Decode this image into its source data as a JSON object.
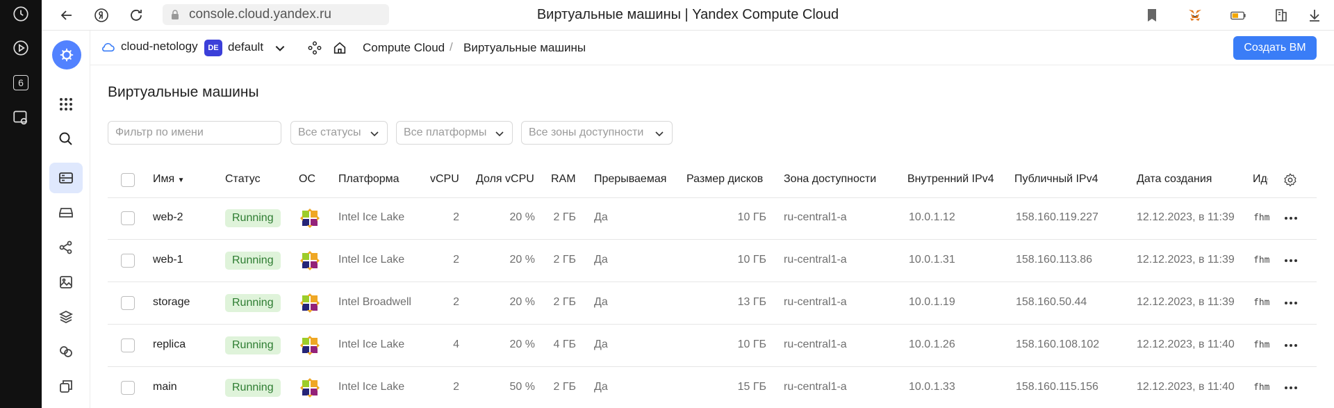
{
  "browser": {
    "url": "console.cloud.yandex.ru",
    "page_title": "Виртуальные машины | Yandex Compute Cloud"
  },
  "os_sidebar": {
    "badge": "6"
  },
  "header": {
    "cloud": "cloud-netology",
    "folder_badge": "DE",
    "folder": "default",
    "breadcrumbs": [
      "Compute Cloud",
      "Виртуальные машины"
    ],
    "create_button": "Создать ВМ"
  },
  "page": {
    "title": "Виртуальные машины"
  },
  "filters": {
    "name_placeholder": "Фильтр по имени",
    "status": "Все статусы",
    "platform": "Все платформы",
    "zone": "Все зоны доступности"
  },
  "table": {
    "columns": [
      "Имя",
      "Статус",
      "ОС",
      "Платформа",
      "vCPU",
      "Доля vCPU",
      "RAM",
      "Прерываемая",
      "Размер дисков",
      "Зона доступности",
      "Внутренний IPv4",
      "Публичный IPv4",
      "Дата создания",
      "Иде"
    ],
    "rows": [
      {
        "name": "web-2",
        "status": "Running",
        "platform": "Intel Ice Lake",
        "vcpu": "2",
        "vcpu_share": "20 %",
        "ram": "2 ГБ",
        "preemptible": "Да",
        "disk": "10 ГБ",
        "zone": "ru-central1-a",
        "ip_internal": "10.0.1.12",
        "ip_public": "158.160.119.227",
        "created": "12.12.2023, в 11:39",
        "id": "fhm"
      },
      {
        "name": "web-1",
        "status": "Running",
        "platform": "Intel Ice Lake",
        "vcpu": "2",
        "vcpu_share": "20 %",
        "ram": "2 ГБ",
        "preemptible": "Да",
        "disk": "10 ГБ",
        "zone": "ru-central1-a",
        "ip_internal": "10.0.1.31",
        "ip_public": "158.160.113.86",
        "created": "12.12.2023, в 11:39",
        "id": "fhm"
      },
      {
        "name": "storage",
        "status": "Running",
        "platform": "Intel Broadwell",
        "vcpu": "2",
        "vcpu_share": "20 %",
        "ram": "2 ГБ",
        "preemptible": "Да",
        "disk": "13 ГБ",
        "zone": "ru-central1-a",
        "ip_internal": "10.0.1.19",
        "ip_public": "158.160.50.44",
        "created": "12.12.2023, в 11:39",
        "id": "fhm"
      },
      {
        "name": "replica",
        "status": "Running",
        "platform": "Intel Ice Lake",
        "vcpu": "4",
        "vcpu_share": "20 %",
        "ram": "4 ГБ",
        "preemptible": "Да",
        "disk": "10 ГБ",
        "zone": "ru-central1-a",
        "ip_internal": "10.0.1.26",
        "ip_public": "158.160.108.102",
        "created": "12.12.2023, в 11:40",
        "id": "fhm"
      },
      {
        "name": "main",
        "status": "Running",
        "platform": "Intel Ice Lake",
        "vcpu": "2",
        "vcpu_share": "50 %",
        "ram": "2 ГБ",
        "preemptible": "Да",
        "disk": "15 ГБ",
        "zone": "ru-central1-a",
        "ip_internal": "10.0.1.33",
        "ip_public": "158.160.115.156",
        "created": "12.12.2023, в 11:40",
        "id": "fhm"
      }
    ]
  },
  "colors": {
    "accent": "#3a7df7",
    "status_bg": "#dff3da",
    "status_text": "#2e7d32",
    "folder_badge": "#3b3fd9"
  }
}
